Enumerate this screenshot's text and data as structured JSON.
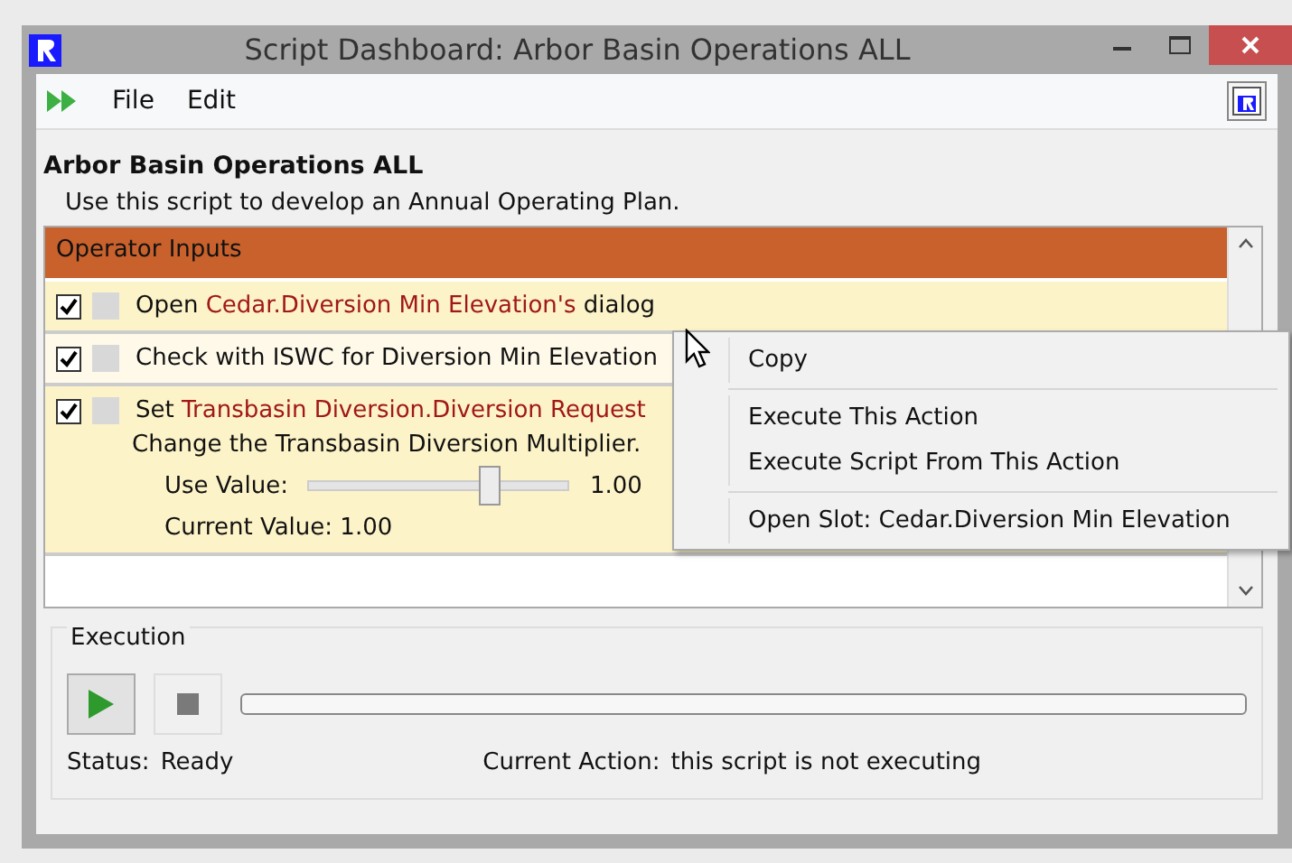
{
  "window": {
    "title": "Script Dashboard: Arbor Basin Operations ALL"
  },
  "menu": [
    "File",
    "Edit"
  ],
  "script": {
    "name": "Arbor Basin Operations ALL",
    "description": "Use this script to develop an Annual Operating Plan."
  },
  "inputs": {
    "header": "Operator Inputs",
    "actions": [
      {
        "checked": true,
        "parts": [
          {
            "kind": "plain",
            "text": "Open "
          },
          {
            "kind": "slot",
            "text": "Cedar.Diversion Min Elevation's"
          },
          {
            "kind": "plain",
            "text": " dialog"
          }
        ]
      },
      {
        "checked": true,
        "parts": [
          {
            "kind": "plain",
            "text": "Check with ISWC for Diversion Min Elevation"
          }
        ]
      },
      {
        "checked": true,
        "parts": [
          {
            "kind": "plain",
            "text": "Set "
          },
          {
            "kind": "slot",
            "text": "Transbasin Diversion.Diversion Request"
          }
        ],
        "note": "Change the Transbasin Diversion Multiplier.",
        "use_label": "Use Value:",
        "level": 0.69,
        "use_value": "1.00",
        "current": "Current Value: 1.00"
      }
    ]
  },
  "context_menu": [
    {
      "kind": "item",
      "label": "Copy"
    },
    {
      "kind": "separator"
    },
    {
      "kind": "item",
      "label": "Execute This Action"
    },
    {
      "kind": "item",
      "label": "Execute Script From This Action"
    },
    {
      "kind": "separator"
    },
    {
      "kind": "item",
      "label": "Open Slot: Cedar.Diversion Min Elevation"
    }
  ],
  "execution": {
    "title": "Execution",
    "status_label": "Status:",
    "status": "Ready",
    "action_label": "Current Action:",
    "action": "this script is not executing"
  }
}
